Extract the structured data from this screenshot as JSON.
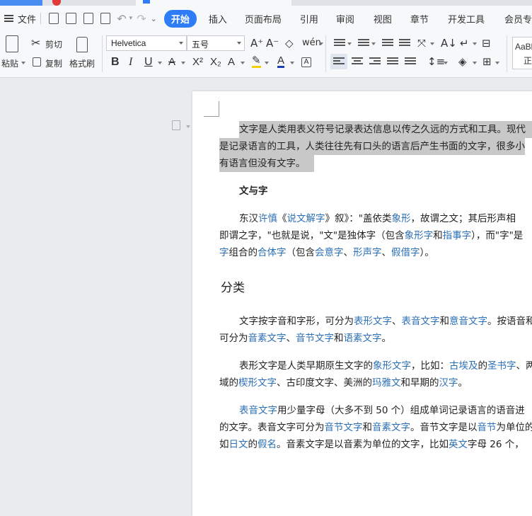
{
  "menu": {
    "file": "文件",
    "tabs": [
      "开始",
      "插入",
      "页面布局",
      "引用",
      "审阅",
      "视图",
      "章节",
      "开发工具",
      "会员专"
    ]
  },
  "ribbon": {
    "paste": "粘贴",
    "cut": "剪切",
    "copy": "复制",
    "format_painter": "格式刷",
    "font_name": "Helvetica",
    "font_size": "五号",
    "style_sample": "AaBb",
    "style_sample2": "正"
  },
  "document": {
    "p1_line1": "文字是人类用表义符号记录表达信息以传之久远的方式和工具。现代",
    "p1_line2": "是记录语言的工具，人类往往先有口头的语言后产生书面的文字，很多小",
    "p1_line3": "有语言但没有文字。",
    "h_wenyuzi": "文与字",
    "p2_line1": [
      "东汉",
      "许慎",
      "《",
      "说文解字",
      "》叙》：\"盖依类",
      "象形",
      "，故谓之文；其后形声相"
    ],
    "p2_line2": [
      "即谓之字，\"也就是说，\"文\"是独体字（包含",
      "象形字",
      "和",
      "指事字",
      "），而\"字\"是"
    ],
    "p2_line3": [
      "字",
      "组合的",
      "合体字",
      "（包含",
      "会意字",
      "、",
      "形声字",
      "、",
      "假借字",
      "）。"
    ],
    "h_fenlei": "分类",
    "p3_line1": [
      "文字按字音和字形，可分为",
      "表形文字",
      "、",
      "表音文字",
      "和",
      "意音文字",
      "。按语音和"
    ],
    "p3_line2": [
      "可分为",
      "音素文字",
      "、",
      "音节文字",
      "和",
      "语素文字",
      "。"
    ],
    "p4_line1": [
      "表形文字是人类早期原生文字的",
      "象形文字",
      "，比如：",
      "古埃及",
      "的",
      "圣书字",
      "、两"
    ],
    "p4_line2": [
      "域的",
      "楔形文字",
      "、古印度文字、美洲的",
      "玛雅文",
      "和早期的",
      "汉字",
      "。"
    ],
    "p5_line1": [
      "表音文字",
      "用少量字母（大多不到 50 个）组成单词记录语言的语音进"
    ],
    "p5_line2": [
      "的文字。表音文字可分为",
      "音节文字",
      "和",
      "音素文字",
      "。音节文字是以",
      "音节",
      "为单位的"
    ],
    "p5_line3": [
      "如",
      "日文",
      "的",
      "假名",
      "。音素文字是以音素为单位的文字，比如",
      "英文",
      "字母 26 个，"
    ]
  }
}
